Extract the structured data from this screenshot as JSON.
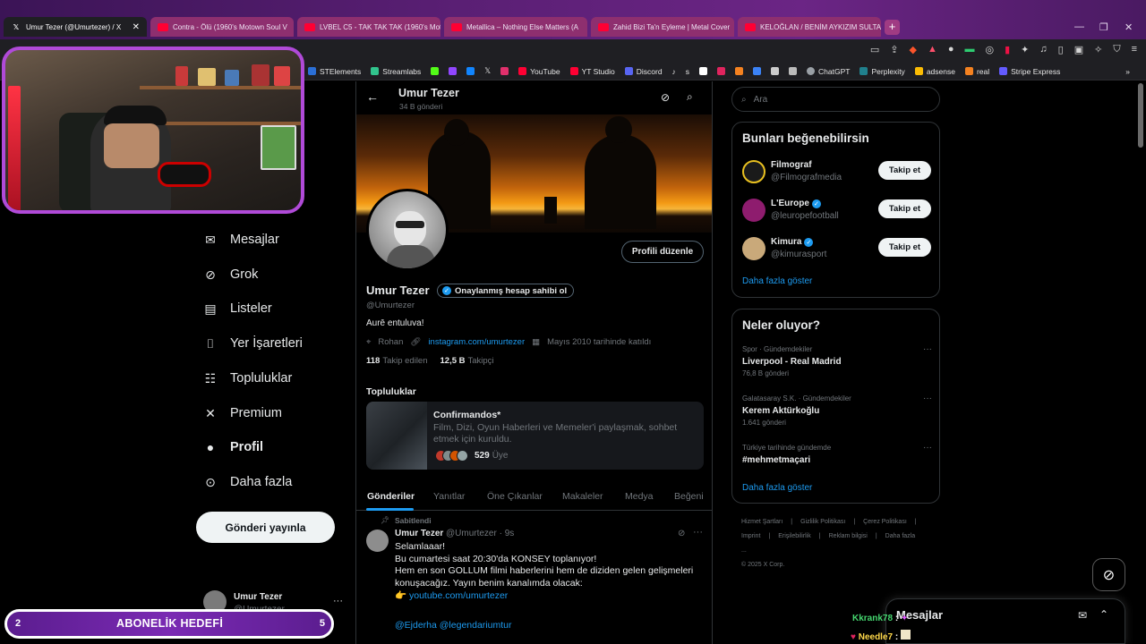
{
  "browser": {
    "tabs": [
      {
        "label": "Umur Tezer (@Umurtezer) / X",
        "active": true,
        "icon": "x-icon"
      },
      {
        "label": "Contra - Ölü (1960's Motown Soul V",
        "active": false,
        "icon": "youtube-icon"
      },
      {
        "label": "LVBEL C5 - TAK TAK TAK (1960's Mot",
        "active": false,
        "icon": "youtube-icon"
      },
      {
        "label": "Metallica – Nothing Else Matters (A",
        "active": false,
        "icon": "youtube-icon"
      },
      {
        "label": "Zahid Bizi Ta'n Eyleme | Metal Cover",
        "active": false,
        "icon": "youtube-icon"
      },
      {
        "label": "KELOĞLAN / BENİM AYKIZIM SULTA",
        "active": false,
        "icon": "youtube-icon"
      }
    ],
    "new_tab": "+",
    "bookmarks": [
      "STElements",
      "Streamlabs",
      "YouTube",
      "YT Studio",
      "Discord",
      "s",
      "ChatGPT",
      "Perplexity",
      "adsense",
      "real",
      "Stripe Express"
    ]
  },
  "nav": {
    "items": [
      {
        "label": "Mesajlar",
        "icon": "mail-icon"
      },
      {
        "label": "Grok",
        "icon": "grok-icon"
      },
      {
        "label": "Listeler",
        "icon": "list-icon"
      },
      {
        "label": "Yer İşaretleri",
        "icon": "bookmark-icon"
      },
      {
        "label": "Topluluklar",
        "icon": "communities-icon"
      },
      {
        "label": "Premium",
        "icon": "x-logo-icon"
      },
      {
        "label": "Profil",
        "icon": "profile-icon"
      },
      {
        "label": "Daha fazla",
        "icon": "more-circle-icon"
      }
    ],
    "post_button": "Gönderi yayınla",
    "account": {
      "name": "Umur Tezer",
      "handle": "@Umurtezer"
    }
  },
  "stream_overlay": {
    "sub_goal": {
      "current": "2",
      "label": "ABONELİK HEDEFİ",
      "target": "5"
    },
    "chat": [
      {
        "user": "Kkrank78",
        "sep": ":"
      },
      {
        "user": "Needle7",
        "sep": ":"
      }
    ]
  },
  "profile": {
    "header_name": "Umur Tezer",
    "post_count": "34 B gönderi",
    "name": "Umur Tezer",
    "verify_cta": "Onaylanmış hesap sahibi ol",
    "handle": "@Umurtezer",
    "bio": "Aurē entuluva!",
    "location": "Rohan",
    "link": "instagram.com/umurtezer",
    "joined": "Mayıs 2010 tarihinde katıldı",
    "following_count": "118",
    "following_label": "Takip edilen",
    "followers_count": "12,5 B",
    "followers_label": "Takipçi",
    "edit_button": "Profili düzenle"
  },
  "communities": {
    "title": "Topluluklar",
    "card": {
      "name": "Confirmandos*",
      "description": "Film, Dizi, Oyun Haberleri ve Memeler'i paylaşmak, sohbet etmek için kuruldu.",
      "members_count": "529",
      "members_label": "Üye"
    }
  },
  "tabs": [
    "Gönderiler",
    "Yanıtlar",
    "Öne Çıkanlar",
    "Makaleler",
    "Medya",
    "Beğeni"
  ],
  "pinned_post": {
    "pinned_label": "Sabitlendi",
    "author": "Umur Tezer",
    "handle": "@Umurtezer · 9s",
    "text_lines": [
      "Selamlaaar!",
      "Bu cumartesi saat 20:30'da KONSEY toplanıyor!",
      "Hem en son GOLLUM filmi haberlerini hem de diziden gelen gelişmeleri",
      "konuşacağız. Yayın benim kanalımda olacak:"
    ],
    "link_emoji": "👉",
    "link": "youtube.com/umurtezer",
    "mentions": "@Ejderha @legendariumtur"
  },
  "sidebar": {
    "search_placeholder": "Ara",
    "suggestions_title": "Bunları beğenebilirsin",
    "suggestions": [
      {
        "name": "Filmograf",
        "handle": "@Filmografmedia",
        "verified": false,
        "button": "Takip et",
        "color": "#e8c020"
      },
      {
        "name": "L'Europe",
        "handle": "@leuropefootball",
        "verified": true,
        "button": "Takip et",
        "color": "#8e1c6e"
      },
      {
        "name": "Kimura",
        "handle": "@kimurasport",
        "verified": true,
        "button": "Takip et",
        "color": "#6a4a2a"
      }
    ],
    "show_more": "Daha fazla göster",
    "trends_title": "Neler oluyor?",
    "trends": [
      {
        "context": "Spor · Gündemdekiler",
        "title": "Liverpool - Real Madrid",
        "count": "76,8 B gönderi"
      },
      {
        "context": "Galatasaray S.K. · Gündemdekiler",
        "title": "Kerem Aktürkoğlu",
        "count": "1.641 gönderi"
      },
      {
        "context": "Türkiye tarihinde gündemde",
        "title": "#mehmetmaçari",
        "count": ""
      }
    ],
    "trends_show_more": "Daha fazla göster",
    "footer": [
      "Hizmet Şartları",
      "|",
      "Gizlilik Politikası",
      "|",
      "Çerez Politikası",
      "|",
      "Imprint",
      "|",
      "Erişilebilirlik",
      "|",
      "Reklam bilgisi",
      "|",
      "Daha fazla ...",
      "© 2025 X Corp."
    ]
  },
  "dm_panel": {
    "title": "Mesajlar"
  },
  "colors": {
    "accent": "#1d9bf0",
    "background": "#000000",
    "stream_purple": "#b04ad8"
  }
}
